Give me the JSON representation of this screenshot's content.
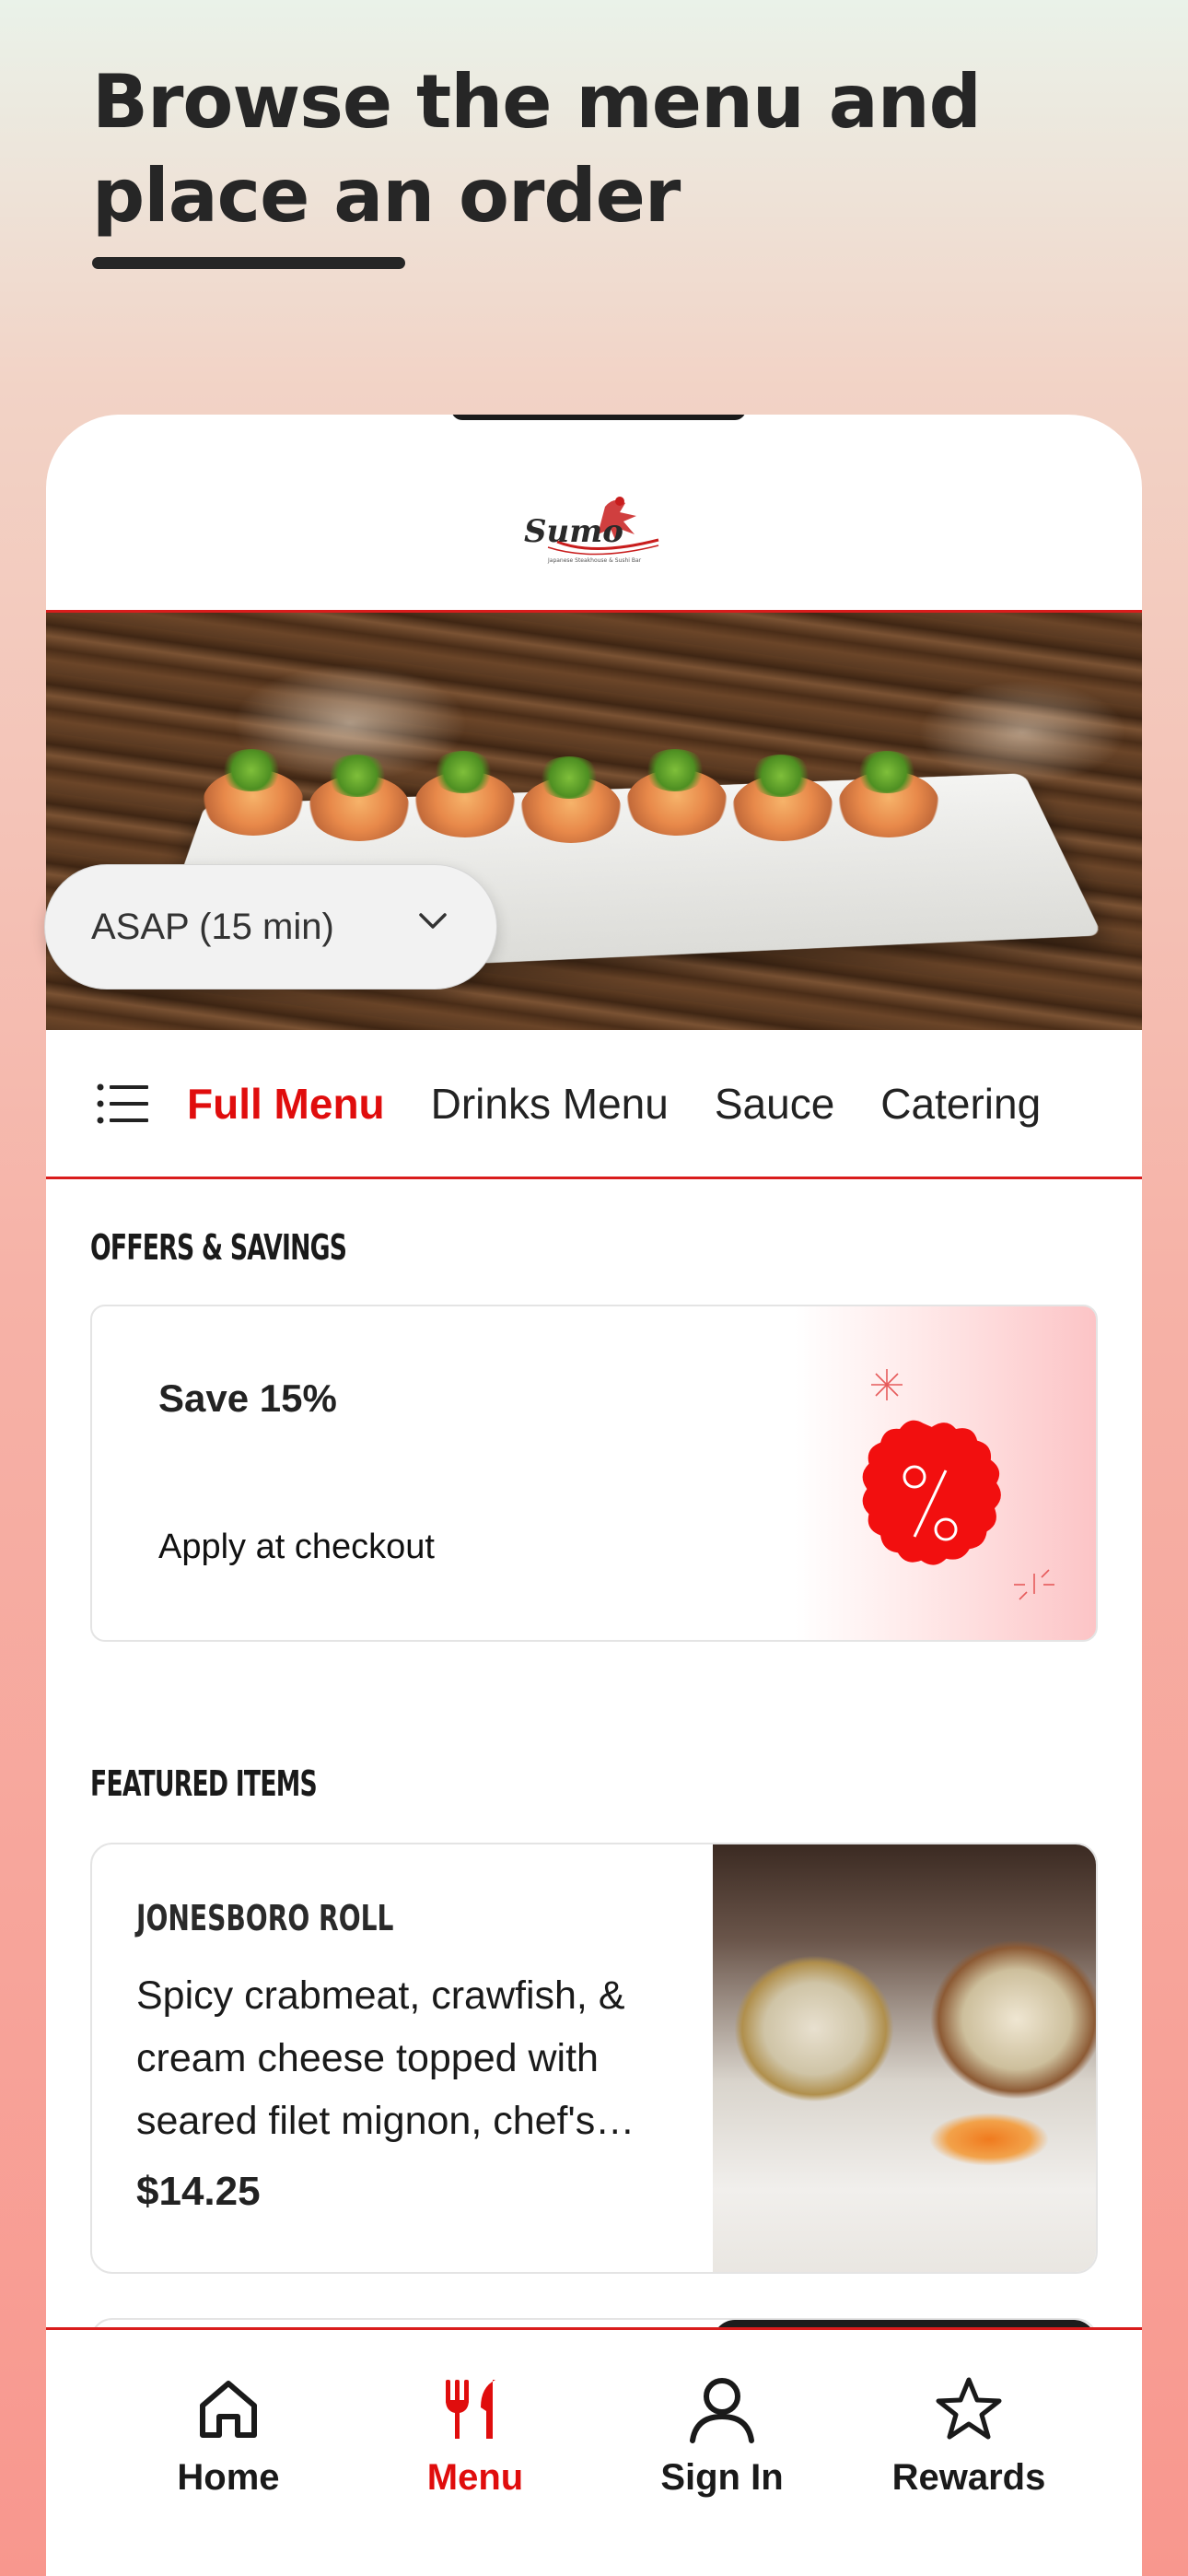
{
  "headline": {
    "line1": "Browse the menu and",
    "line2": "place an order"
  },
  "app": {
    "brand": "Sumo",
    "brand_tagline": "Japanese Steakhouse & Sushi Bar",
    "accent_color": "#e00d0d"
  },
  "order_time": {
    "value": "ASAP (15 min)",
    "icon": "chevron-down-icon"
  },
  "menu_tabs": {
    "icon": "list-icon",
    "items": [
      {
        "label": "Full Menu",
        "active": true
      },
      {
        "label": "Drinks Menu",
        "active": false
      },
      {
        "label": "Sauce",
        "active": false
      },
      {
        "label": "Catering",
        "active": false
      }
    ]
  },
  "offers": {
    "section_title": "OFFERS & SAVINGS",
    "card": {
      "title": "Save 15%",
      "subtitle": "Apply at checkout",
      "icon": "percent-badge-icon"
    }
  },
  "featured": {
    "section_title": "FEATURED ITEMS",
    "items": [
      {
        "name": "JONESBORO ROLL",
        "description": "Spicy crabmeat, crawfish, & cream cheese topped with seared filet mignon, chef's…",
        "price": "$14.25"
      }
    ]
  },
  "bottom_nav": {
    "items": [
      {
        "label": "Home",
        "icon": "home-icon",
        "active": false
      },
      {
        "label": "Menu",
        "icon": "fork-knife-icon",
        "active": true
      },
      {
        "label": "Sign In",
        "icon": "user-icon",
        "active": false
      },
      {
        "label": "Rewards",
        "icon": "star-icon",
        "active": false
      }
    ]
  }
}
